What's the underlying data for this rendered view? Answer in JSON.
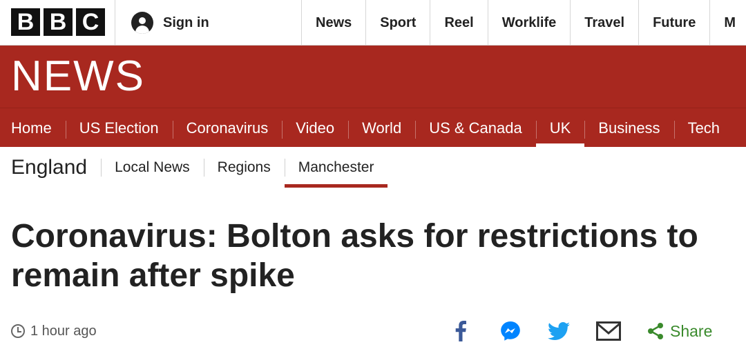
{
  "brand": {
    "logo_letters": [
      "B",
      "B",
      "C"
    ],
    "section_word": "NEWS",
    "red": "#a8281f"
  },
  "account": {
    "signin_label": "Sign in",
    "icon": "user-icon"
  },
  "top_nav": {
    "items": [
      "News",
      "Sport",
      "Reel",
      "Worklife",
      "Travel",
      "Future",
      "M"
    ]
  },
  "section_nav": {
    "items": [
      "Home",
      "US Election",
      "Coronavirus",
      "Video",
      "World",
      "US & Canada",
      "UK",
      "Business",
      "Tech"
    ],
    "active": "UK"
  },
  "sub_nav": {
    "title": "England",
    "items": [
      "Local News",
      "Regions",
      "Manchester"
    ],
    "active": "Manchester"
  },
  "article": {
    "headline": "Coronavirus: Bolton asks for restrictions to remain after spike",
    "timestamp": "1 hour ago"
  },
  "share": {
    "icons": [
      "facebook-icon",
      "messenger-icon",
      "twitter-icon",
      "email-icon",
      "share-icon"
    ],
    "label": "Share",
    "colors": {
      "facebook": "#3b5998",
      "messenger": "#0084ff",
      "twitter": "#1da1f2",
      "email": "#333333",
      "share": "#3a8a2c"
    }
  }
}
